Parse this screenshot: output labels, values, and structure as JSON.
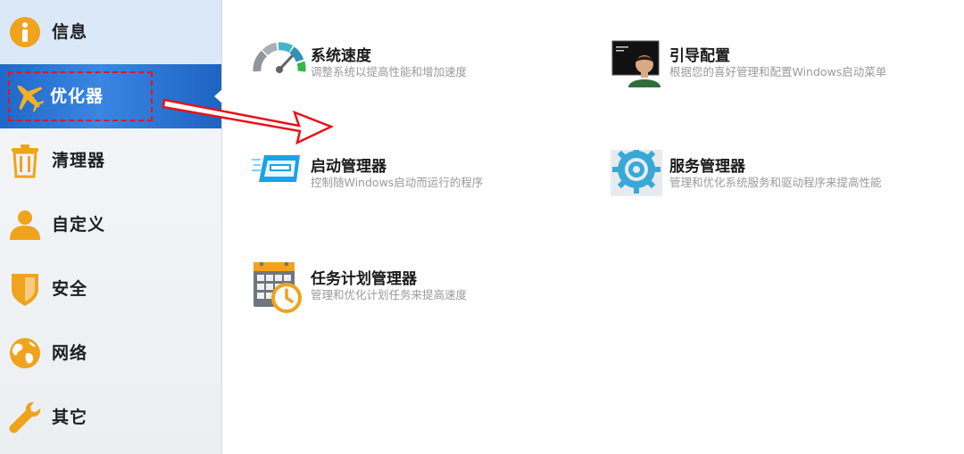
{
  "sidebar": {
    "items": [
      {
        "label": "信息",
        "icon": "info-icon"
      },
      {
        "label": "优化器",
        "icon": "airplane-icon",
        "selected": true
      },
      {
        "label": "清理器",
        "icon": "trash-icon"
      },
      {
        "label": "自定义",
        "icon": "user-icon"
      },
      {
        "label": "安全",
        "icon": "shield-icon"
      },
      {
        "label": "网络",
        "icon": "globe-icon"
      },
      {
        "label": "其它",
        "icon": "wrench-icon"
      }
    ]
  },
  "tools": [
    {
      "title": "系统速度",
      "desc": "调整系统以提高性能和增加速度",
      "icon": "speedometer-icon"
    },
    {
      "title": "引导配置",
      "desc": "根据您的喜好管理和配置Windows启动菜单",
      "icon": "boot-config-icon"
    },
    {
      "title": "启动管理器",
      "desc": "控制随Windows启动而运行的程序",
      "icon": "startup-manager-icon"
    },
    {
      "title": "服务管理器",
      "desc": "管理和优化系统服务和驱动程序来提高性能",
      "icon": "gear-icon"
    },
    {
      "title": "任务计划管理器",
      "desc": "管理和优化计划任务来提高速度",
      "icon": "calendar-clock-icon"
    }
  ],
  "colors": {
    "accent": "#2b78d8",
    "icon_orange": "#f0a31c",
    "annotation_red": "#e8121a"
  }
}
